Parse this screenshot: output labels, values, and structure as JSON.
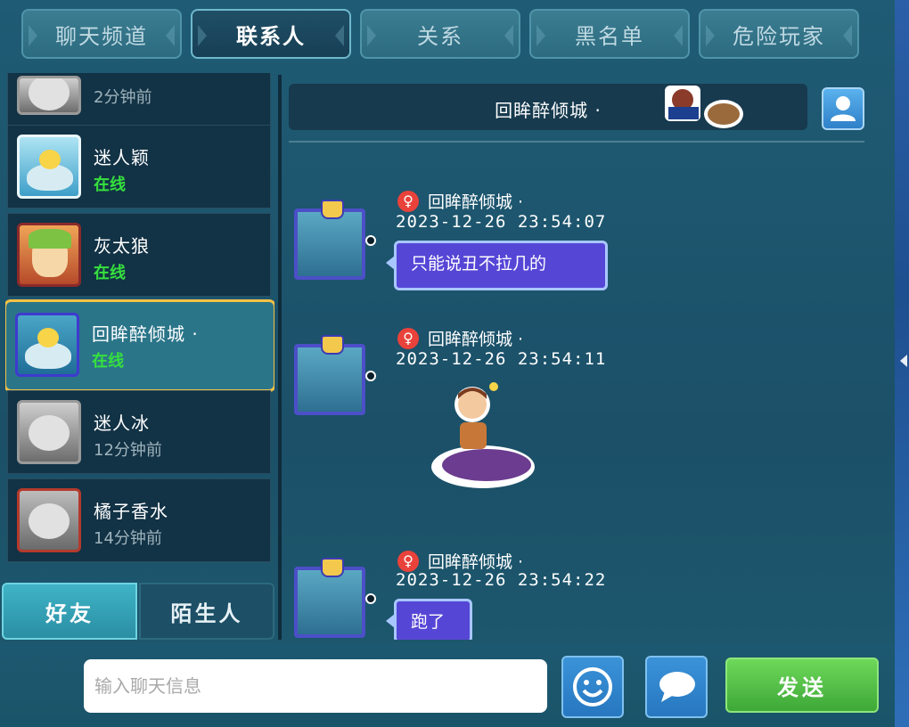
{
  "tabs": [
    "聊天频道",
    "联系人",
    "关系",
    "黑名单",
    "危险玩家"
  ],
  "contacts": [
    {
      "name": "",
      "status": "2分钟前",
      "online": false
    },
    {
      "name": "迷人颖",
      "status": "在线",
      "online": true
    },
    {
      "name": "灰太狼",
      "status": "在线",
      "online": true
    },
    {
      "name": "回眸醉倾城 ·",
      "status": "在线",
      "online": true
    },
    {
      "name": "迷人冰",
      "status": "12分钟前",
      "online": false
    },
    {
      "name": "橘子香水",
      "status": "14分钟前",
      "online": false
    }
  ],
  "friend_tabs": {
    "friends": "好友",
    "strangers": "陌生人"
  },
  "chat": {
    "title": "回眸醉倾城 ·",
    "messages": [
      {
        "sender": "回眸醉倾城 ·",
        "time": "2023-12-26  23:54:07",
        "text": "只能说丑不拉几的"
      },
      {
        "sender": "回眸醉倾城 ·",
        "time": "2023-12-26  23:54:11",
        "text": ""
      },
      {
        "sender": "回眸醉倾城 ·",
        "time": "2023-12-26  23:54:22",
        "text": "跑了"
      }
    ]
  },
  "input": {
    "placeholder": "输入聊天信息"
  },
  "send_label": "发送",
  "gender_symbol": "♀",
  "colors": {
    "accent": "#f5c146",
    "online": "#36e03e",
    "bubble": "#5646d6",
    "send": "#4fc046"
  }
}
